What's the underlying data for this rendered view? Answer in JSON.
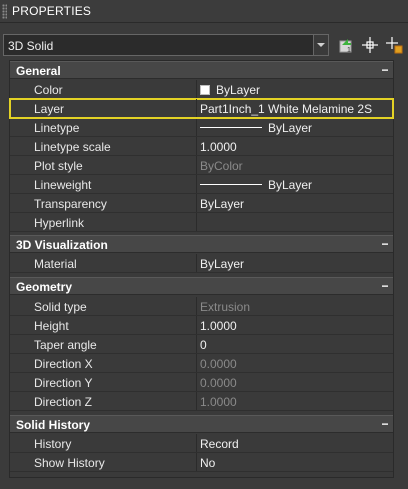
{
  "palette": {
    "title": "PROPERTIES"
  },
  "selector": {
    "value": "3D Solid"
  },
  "toolbar": {
    "buttons": [
      {
        "icon": "toggle-pickadd-icon"
      },
      {
        "icon": "select-objects-icon"
      },
      {
        "icon": "quick-select-icon"
      }
    ]
  },
  "sections": {
    "general": {
      "label": "General",
      "collapse": "−",
      "rows": [
        {
          "name": "Color",
          "value": "ByLayer"
        },
        {
          "name": "Layer",
          "value": "Part1Inch_1 White Melamine 2S"
        },
        {
          "name": "Linetype",
          "value": "ByLayer"
        },
        {
          "name": "Linetype scale",
          "value": "1.0000"
        },
        {
          "name": "Plot style",
          "value": "ByColor"
        },
        {
          "name": "Lineweight",
          "value": "ByLayer"
        },
        {
          "name": "Transparency",
          "value": "ByLayer"
        },
        {
          "name": "Hyperlink",
          "value": ""
        }
      ]
    },
    "visualization": {
      "label": "3D Visualization",
      "collapse": "−",
      "rows": [
        {
          "name": "Material",
          "value": "ByLayer"
        }
      ]
    },
    "geometry": {
      "label": "Geometry",
      "collapse": "−",
      "rows": [
        {
          "name": "Solid type",
          "value": "Extrusion"
        },
        {
          "name": "Height",
          "value": "1.0000"
        },
        {
          "name": "Taper angle",
          "value": "0"
        },
        {
          "name": "Direction X",
          "value": "0.0000"
        },
        {
          "name": "Direction Y",
          "value": "0.0000"
        },
        {
          "name": "Direction Z",
          "value": "1.0000"
        }
      ]
    },
    "history": {
      "label": "Solid History",
      "collapse": "−",
      "rows": [
        {
          "name": "History",
          "value": "Record"
        },
        {
          "name": "Show History",
          "value": "No"
        }
      ]
    }
  },
  "colors": {
    "highlight": "#e3d225",
    "background": "#3b3b3b",
    "header": "#474747"
  }
}
